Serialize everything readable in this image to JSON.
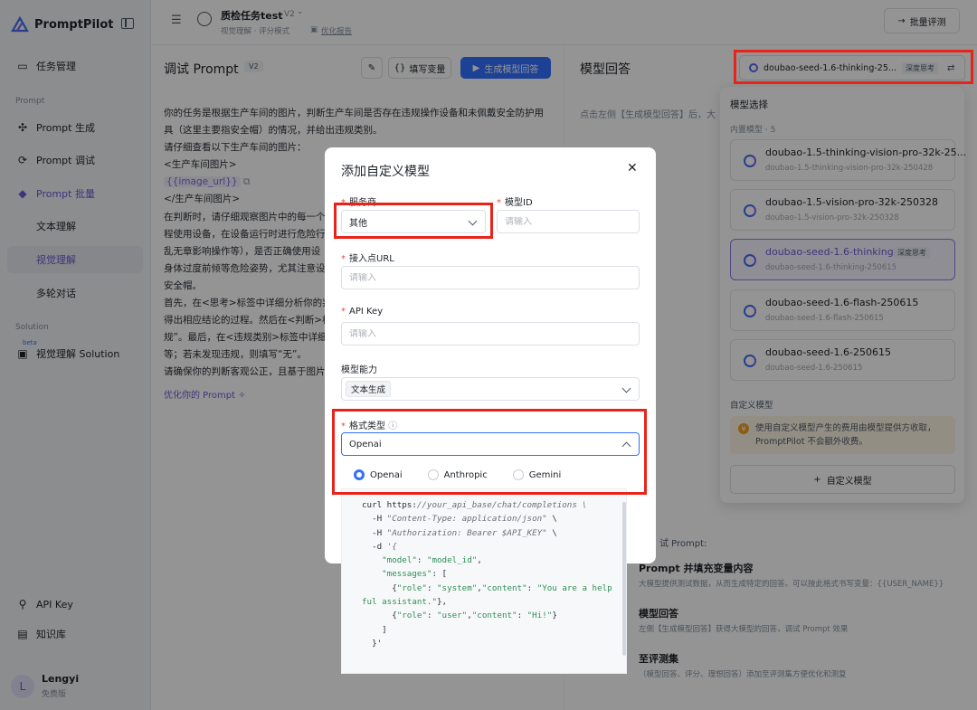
{
  "brand": {
    "name": "PromptPilot"
  },
  "sidebar": {
    "task_mgmt": "任务管理",
    "section_prompt": "Prompt",
    "gen": "Prompt 生成",
    "debug": "Prompt 调试",
    "batch": "Prompt 批量",
    "text_understanding": "文本理解",
    "visual_understanding": "视觉理解",
    "multi_turn": "多轮对话",
    "section_solution": "Solution",
    "beta": "beta",
    "visual_solution": "视觉理解 Solution",
    "api_key": "API Key",
    "knowledge": "知识库",
    "user_name": "Lengyi",
    "user_plan": "免费版",
    "avatar_letter": "L"
  },
  "topbar": {
    "task_title": "质检任务test",
    "version": "V2",
    "sub1": "视觉理解 · 评分模式",
    "sub2": "优化报告",
    "batch_eval": "批量评测"
  },
  "main": {
    "title": "调试 Prompt",
    "version": "V2",
    "fill_vars": "填写变量",
    "generate": "生成模型回答",
    "lines": [
      "你的任务是根据生产车间的图片，判断生产车间是否存在违规操作设备和未佩戴安全防护用",
      "具（这里主要指安全帽）的情况，并给出违规类别。",
      "请仔细查看以下生产车间的图片：",
      "<生产车间图片>",
      "{{image_url}}",
      "</生产车间图片>",
      "在判断时，请仔细观察图片中的每一个",
      "程使用设备，在设备运行时进行危险行",
      "乱无章影响操作等），是否正确使用设",
      "身体过度前倾等危险姿势，尤其注意设",
      "安全帽。",
      "首先，在<思考>标签中详细分析你的判",
      "得出相应结论的过程。然后在<判断>标",
      "规”。最后，在<违规类别>标签中详细",
      "等；若未发现违规，则填写“无”。",
      "请确保你的判断客观公正，且基于图片"
    ],
    "optimize": "优化你的 Prompt"
  },
  "right": {
    "title": "模型回答",
    "selected_model": "doubao-seed-1.6-thinking-25...",
    "deep_think": "深度思考",
    "hint": "点击左侧【生成模型回答】后，大",
    "debug_label": "试 Prompt:",
    "step1_title": "Prompt 并填充变量内容",
    "step1_desc": "大模型提供测试数据，从而生成特定的回答。可以按此格式书写变量：{{USER_NAME}}",
    "step2_title": "模型回答",
    "step2_desc": "左侧【生成模型回答】获得大模型的回答，调试 Prompt 效果",
    "step3_title": "至评测集",
    "step3_desc": "（模型回答、评分、理想回答）添加至评测集方便优化和测复"
  },
  "dropdown": {
    "title": "模型选择",
    "builtin_label": "内置模型 · 5",
    "models": [
      {
        "name": "doubao-1.5-thinking-vision-pro-32k-25...",
        "id": "doubao-1.5-thinking-vision-pro-32k-250428"
      },
      {
        "name": "doubao-1.5-vision-pro-32k-250328",
        "id": "doubao-1.5-vision-pro-32k-250328"
      },
      {
        "name": "doubao-seed-1.6-thinking-...",
        "id": "doubao-seed-1.6-thinking-250615",
        "tag": "深度思考"
      },
      {
        "name": "doubao-seed-1.6-flash-250615",
        "id": "doubao-seed-1.6-flash-250615"
      },
      {
        "name": "doubao-seed-1.6-250615",
        "id": "doubao-seed-1.6-250615"
      }
    ],
    "custom_label": "自定义模型",
    "notice": "使用自定义模型产生的费用由模型提供方收取，PromptPilot 不会额外收费。",
    "add_custom": "自定义模型"
  },
  "modal": {
    "title": "添加自定义模型",
    "provider_label": "服务商",
    "provider_value": "其他",
    "model_id_label": "模型ID",
    "model_id_placeholder": "请输入",
    "endpoint_label": "接入点URL",
    "endpoint_placeholder": "请输入",
    "apikey_label": "API Key",
    "apikey_placeholder": "请输入",
    "capability_label": "模型能力",
    "capability_tag": "文本生成",
    "format_label": "格式类型",
    "format_value": "Openai",
    "formats": [
      "Openai",
      "Anthropic",
      "Gemini"
    ],
    "code": {
      "l1a": "curl https:",
      "l1b": "//your_api_base/chat/completions \\",
      "l2a": "  -H ",
      "l2b": "\"Content-Type: application/json\"",
      "l2c": " \\",
      "l3a": "  -H ",
      "l3b": "\"Authorization: Bearer $API_KEY\"",
      "l3c": " \\",
      "l4a": "  -d ",
      "l4b": "'{",
      "l5a": "    ",
      "l5b": "\"model\"",
      "l5c": ": ",
      "l5d": "\"model_id\"",
      "l5e": ",",
      "l6a": "    ",
      "l6b": "\"messages\"",
      "l6c": ": [",
      "l7a": "      {",
      "l7b": "\"role\"",
      "l7c": ": ",
      "l7d": "\"system\"",
      "l7e": ",",
      "l7f": "\"content\"",
      "l7g": ": ",
      "l7h": "\"You are a help",
      "l8a": "ful assistant.\"",
      "l8b": "},",
      "l9a": "      {",
      "l9b": "\"role\"",
      "l9c": ": ",
      "l9d": "\"user\"",
      "l9e": ",",
      "l9f": "\"content\"",
      "l9g": ": ",
      "l9h": "\"Hi!\"",
      "l9i": "}",
      "l10": "    ]",
      "l11": "  }'"
    }
  }
}
